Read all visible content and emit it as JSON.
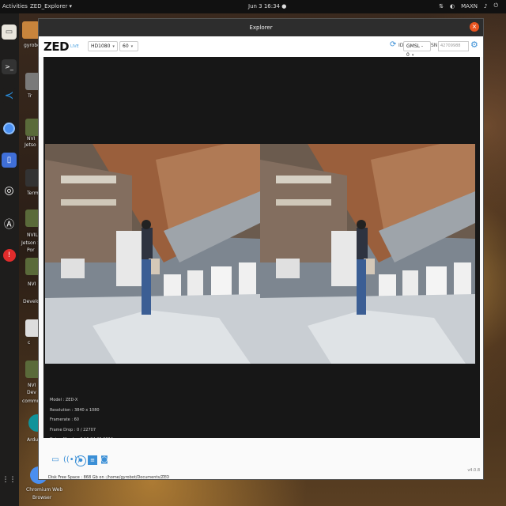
{
  "topbar": {
    "activities": "Activities",
    "app_menu": "ZED_Explorer ▾",
    "clock": "Jun 3  16:34 ●",
    "tray_mode": "MAXN"
  },
  "dock": {
    "items": [
      "files-icon",
      "terminal-icon",
      "vscode-icon",
      "chromium-icon",
      "screen-icon",
      "obs-icon",
      "software-icon",
      "help-icon",
      "apps-icon"
    ]
  },
  "desktop": {
    "labels": [
      "gyrobot",
      "Tr",
      "NVI",
      "Jetso",
      "Term",
      "NVIL",
      "Jetson Sd",
      "Por",
      "NVI",
      "Develop",
      "c",
      "NVI",
      "Dev",
      "commun",
      "Arduino ID",
      "Chromium Web",
      "Browser"
    ]
  },
  "window": {
    "title": "Explorer",
    "close": "×",
    "logo": "ZED",
    "live": "LIVE",
    "resolution": "HD1080",
    "fps": "60",
    "id_label": "ID",
    "interface": "GMSL - 0",
    "sn_label": "SN",
    "serial_placeholder": "42709988"
  },
  "info": {
    "model": "Model : ZED-X",
    "resolution": "Resolution : 3840 x 1080",
    "framerate": "Framerate : 60",
    "frame_drop": "Frame Drop : 0 / 22707",
    "date": "Date : Mon Jun 3 16:34:22 2024"
  },
  "status": {
    "disk": "Disk Free Space : 868 Gb  on :/home/gyrobot/Documents/ZED",
    "version": "v4.0.8"
  },
  "colors": {
    "accent": "#3b8fd6",
    "close": "#e95420"
  }
}
